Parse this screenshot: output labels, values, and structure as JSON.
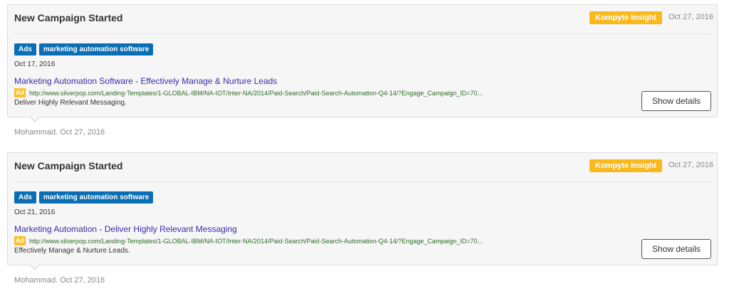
{
  "cards": [
    {
      "title": "New Campaign Started",
      "badge": "Kompyte Insight",
      "header_date": "Oct 27, 2016",
      "tags": [
        "Ads",
        "marketing automation software"
      ],
      "ad_date": "Oct 17, 2016",
      "headline": "Marketing Automation Software - Effectively Manage & Nurture Leads",
      "ad_label": "Ad",
      "url": "http://www.silverpop.com/Landing-Templates/1-GLOBAL-IBM/NA-IOT/Inter-NA/2014/Paid-Search/Paid-Search-Automation-Q4-14/?Engage_Campaign_ID=70...",
      "description": "Deliver Highly Relevant Messaging.",
      "button": "Show details",
      "author": "Mohammad. Oct 27, 2016"
    },
    {
      "title": "New Campaign Started",
      "badge": "Kompyte Insight",
      "header_date": "Oct 27, 2016",
      "tags": [
        "Ads",
        "marketing automation software"
      ],
      "ad_date": "Oct 21, 2016",
      "headline": "Marketing Automation - Deliver Highly Relevant Messaging",
      "ad_label": "Ad",
      "url": "http://www.silverpop.com/Landing-Templates/1-GLOBAL-IBM/NA-IOT/Inter-NA/2014/Paid-Search/Paid-Search-Automation-Q4-14/?Engage_Campaign_ID=70...",
      "description": "Effectively Manage & Nurture Leads.",
      "button": "Show details",
      "author": "Mohammad. Oct 27, 2016"
    }
  ],
  "colors": {
    "badge": "#f9b81c",
    "tag": "#0a6eb4",
    "headline_link": "#3b2bab",
    "url": "#2d6b27",
    "ad_label": "#f3c22a"
  }
}
